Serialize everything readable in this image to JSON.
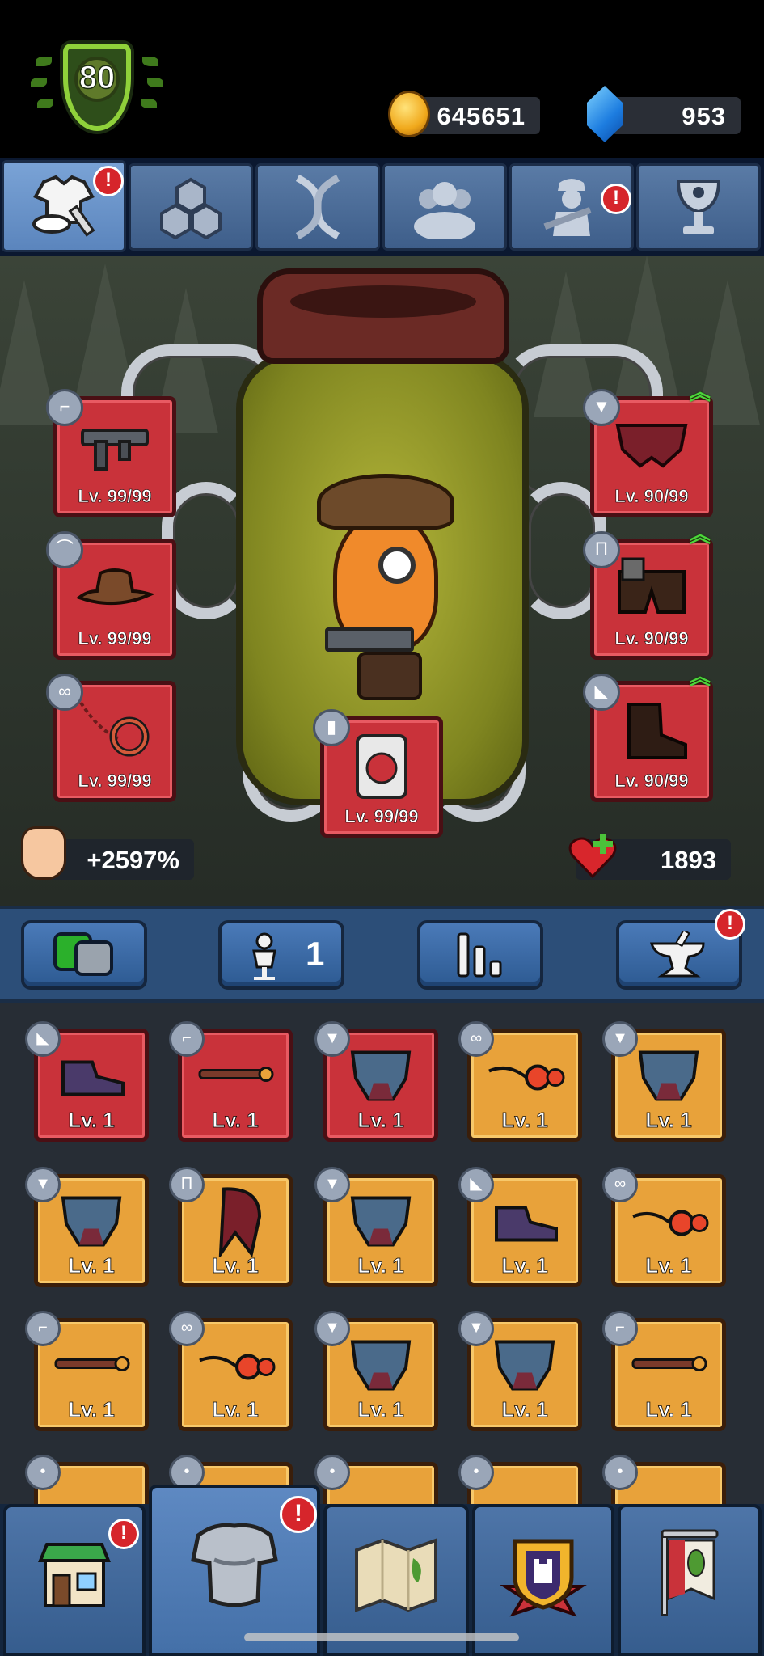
{
  "player": {
    "level": "80"
  },
  "currency": {
    "coins": "645651",
    "gems": "953"
  },
  "tabs": [
    {
      "icon": "equipment-tab-icon",
      "alert": "!"
    },
    {
      "icon": "gems-tab-icon",
      "alert": ""
    },
    {
      "icon": "dna-tab-icon",
      "alert": ""
    },
    {
      "icon": "squad-tab-icon",
      "alert": ""
    },
    {
      "icon": "soldier-tab-icon",
      "alert": "!"
    },
    {
      "icon": "trophy-tab-icon",
      "alert": ""
    }
  ],
  "equipped": {
    "weapon": {
      "level": "Lv. 99/99",
      "type": "gun"
    },
    "hat": {
      "level": "Lv. 99/99",
      "type": "hat"
    },
    "accessory": {
      "level": "Lv. 99/99",
      "type": "glasses"
    },
    "armor": {
      "level": "Lv. 90/99",
      "type": "shirt",
      "upgradable": true
    },
    "pants": {
      "level": "Lv. 90/99",
      "type": "pants",
      "upgradable": true
    },
    "boots": {
      "level": "Lv. 90/99",
      "type": "shoe",
      "upgradable": true
    },
    "consumable": {
      "level": "Lv. 99/99",
      "type": "can"
    }
  },
  "stats": {
    "power": "+2597%",
    "health": "1893"
  },
  "toolbar": {
    "filter_icon": "toggle-icon",
    "loadout_count": "1",
    "sort_icon": "sort-bars-icon",
    "forge_icon": "anvil-icon",
    "forge_alert": "!"
  },
  "inventory": [
    {
      "level": "Lv. 1",
      "rarity": "red",
      "type": "shoe"
    },
    {
      "level": "Lv. 1",
      "rarity": "red",
      "type": "gun"
    },
    {
      "level": "Lv. 1",
      "rarity": "red",
      "type": "shirt"
    },
    {
      "level": "Lv. 1",
      "rarity": "gold",
      "type": "glasses"
    },
    {
      "level": "Lv. 1",
      "rarity": "gold",
      "type": "shirt"
    },
    {
      "level": "Lv. 1",
      "rarity": "gold",
      "type": "shirt"
    },
    {
      "level": "Lv. 1",
      "rarity": "gold",
      "type": "pants"
    },
    {
      "level": "Lv. 1",
      "rarity": "gold",
      "type": "shirt"
    },
    {
      "level": "Lv. 1",
      "rarity": "gold",
      "type": "shoe"
    },
    {
      "level": "Lv. 1",
      "rarity": "gold",
      "type": "glasses"
    },
    {
      "level": "Lv. 1",
      "rarity": "gold",
      "type": "gun"
    },
    {
      "level": "Lv. 1",
      "rarity": "gold",
      "type": "glasses"
    },
    {
      "level": "Lv. 1",
      "rarity": "gold",
      "type": "shirt"
    },
    {
      "level": "Lv. 1",
      "rarity": "gold",
      "type": "shirt"
    },
    {
      "level": "Lv. 1",
      "rarity": "gold",
      "type": "gun"
    }
  ],
  "bottom_nav": [
    {
      "name": "shop",
      "icon": "shop-icon",
      "alert": "!"
    },
    {
      "name": "equipment",
      "icon": "armor-icon",
      "alert": "!",
      "active": true
    },
    {
      "name": "map",
      "icon": "map-icon",
      "alert": ""
    },
    {
      "name": "clan",
      "icon": "castle-shield-icon",
      "alert": ""
    },
    {
      "name": "banner",
      "icon": "banner-icon",
      "alert": ""
    }
  ]
}
